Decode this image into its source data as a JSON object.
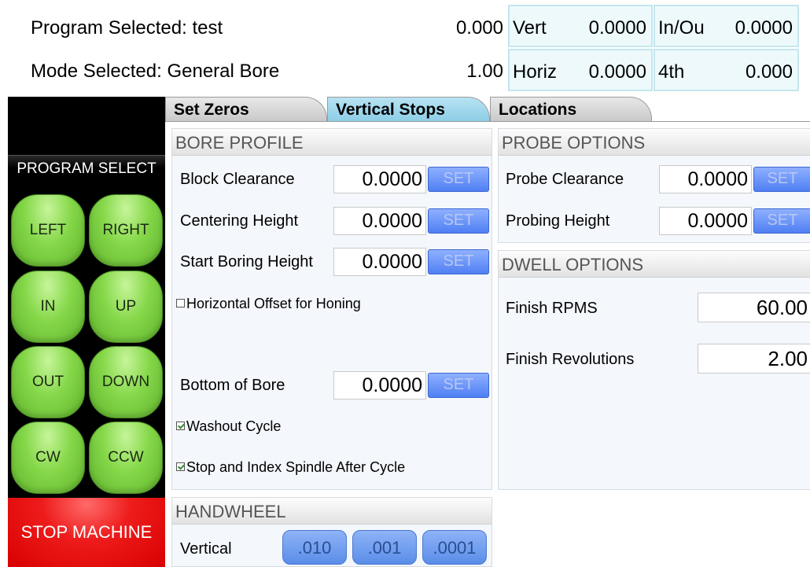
{
  "status": {
    "program_label": "Program Selected:",
    "program_value": "test",
    "mode_label": "Mode Selected:",
    "mode_value": "General Bore",
    "value1": "0.000",
    "value2": "1.00"
  },
  "axes": [
    {
      "name": "Vert",
      "value": "0.0000"
    },
    {
      "name": "Horiz",
      "value": "0.0000"
    },
    {
      "name": "In/Ou",
      "value": "0.0000"
    },
    {
      "name": "4th",
      "value": "0.000"
    }
  ],
  "controls": {
    "program_select": "PROGRAM SELECT",
    "jog": [
      "LEFT",
      "RIGHT",
      "IN",
      "UP",
      "OUT",
      "DOWN",
      "CW",
      "CCW"
    ],
    "stop": "STOP MACHINE",
    "jog_color": "#86d84a",
    "stop_color": "#ee1c1c"
  },
  "tabs": [
    {
      "label": "Set Zeros",
      "active": false
    },
    {
      "label": "Vertical Stops",
      "active": true
    },
    {
      "label": "Locations",
      "active": false
    }
  ],
  "bore_profile": {
    "title": "BORE PROFILE",
    "fields": [
      {
        "label": "Block Clearance",
        "value": "0.0000",
        "button": "SET"
      },
      {
        "label": "Centering Height",
        "value": "0.0000",
        "button": "SET"
      },
      {
        "label": "Start Boring Height",
        "value": "0.0000",
        "button": "SET"
      },
      {
        "label": "Bottom of Bore",
        "value": "0.0000",
        "button": "SET"
      }
    ],
    "checks": [
      {
        "label": "Horizontal Offset for Honing",
        "checked": false
      },
      {
        "label": "Washout Cycle",
        "checked": true
      },
      {
        "label": "Stop and Index Spindle After Cycle",
        "checked": true
      }
    ]
  },
  "probe_options": {
    "title": "PROBE OPTIONS",
    "fields": [
      {
        "label": "Probe Clearance",
        "value": "0.0000",
        "button": "SET"
      },
      {
        "label": "Probing Height",
        "value": "0.0000",
        "button": "SET"
      }
    ]
  },
  "dwell_options": {
    "title": "DWELL OPTIONS",
    "fields": [
      {
        "label": "Finish RPMS",
        "value": "60.00"
      },
      {
        "label": "Finish Revolutions",
        "value": "2.00"
      }
    ]
  },
  "handwheel": {
    "title": "HANDWHEEL",
    "label": "Vertical",
    "increments": [
      ".010",
      ".001",
      ".0001"
    ]
  }
}
